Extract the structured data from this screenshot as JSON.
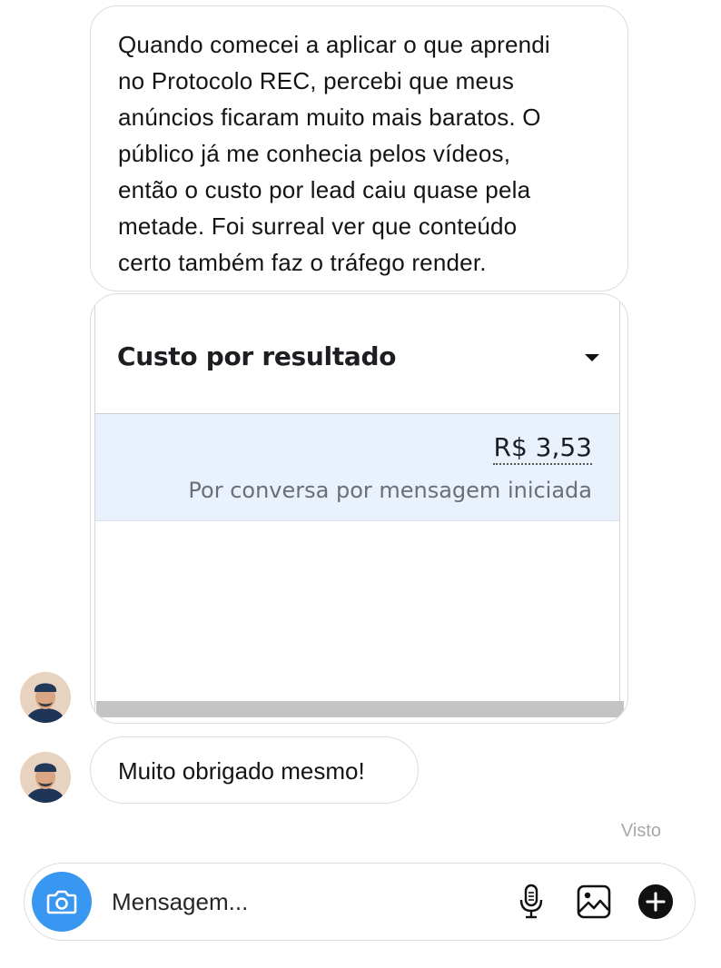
{
  "messages": [
    {
      "type": "text",
      "lines": [
        "Quando comecei a aplicar o que aprendi",
        "no Protocolo REC, percebi que meus",
        "anúncios ficaram muito mais baratos. O",
        "público já me conhecia pelos vídeos,",
        "então o custo por lead caiu quase pela",
        "metade. Foi surreal ver que conteúdo",
        "certo também faz o tráfego render."
      ]
    },
    {
      "type": "image-card",
      "title": "Custo por resultado",
      "value": "R$ 3,53",
      "subtitle": "Por conversa por mensagem iniciada"
    },
    {
      "type": "text",
      "text": "Muito obrigado mesmo!"
    }
  ],
  "status": {
    "seen_label": "Visto"
  },
  "composer": {
    "placeholder": "Mensagem...",
    "icons": [
      "camera-icon",
      "microphone-icon",
      "gallery-icon",
      "plus-icon"
    ]
  },
  "colors": {
    "accent": "#3897f0",
    "highlight_row": "#e9f1fd",
    "bubble_border": "#dcdcdc"
  }
}
